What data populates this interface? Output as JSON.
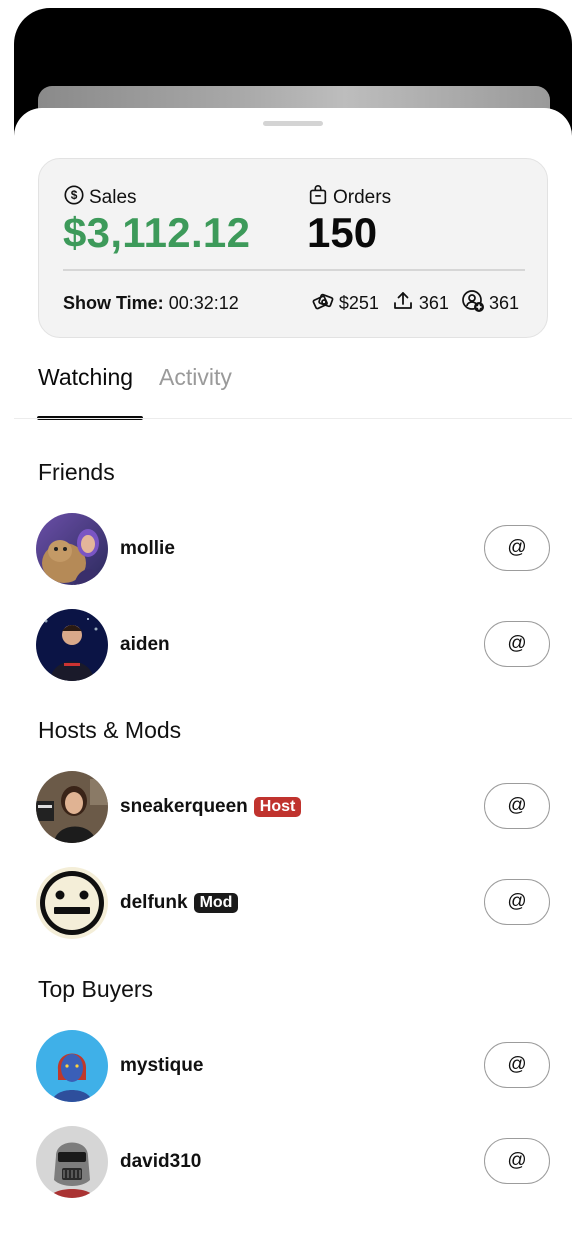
{
  "stats": {
    "sales_label": "Sales",
    "sales_value": "$3,112.12",
    "orders_label": "Orders",
    "orders_value": "150",
    "showtime_label": "Show Time:",
    "showtime_value": " 00:32:12",
    "tips_value": "$251",
    "shares_value": "361",
    "followers_value": "361",
    "sales_color": "#3d9a5a"
  },
  "tabs": [
    {
      "label": "Watching",
      "active": true
    },
    {
      "label": "Activity",
      "active": false
    }
  ],
  "sections": {
    "friends_title": "Friends",
    "hosts_title": "Hosts & Mods",
    "buyers_title": "Top Buyers"
  },
  "users": {
    "mollie": {
      "name": "mollie"
    },
    "aiden": {
      "name": "aiden"
    },
    "sneakerqueen": {
      "name": "sneakerqueen",
      "badge": "Host"
    },
    "delfunk": {
      "name": "delfunk",
      "badge": "Mod"
    },
    "mystique": {
      "name": "mystique"
    },
    "david310": {
      "name": "david310"
    }
  },
  "mention_label": "@"
}
